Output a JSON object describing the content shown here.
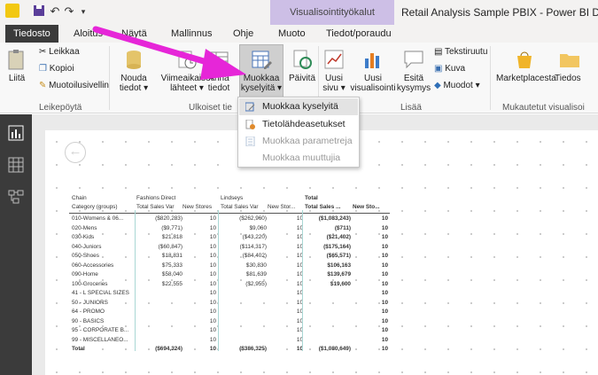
{
  "window": {
    "title": "Retail Analysis Sample PBIX - Power BI Deskto",
    "contextual_tab": "Visualisointityökalut"
  },
  "tabs": [
    "Tiedosto",
    "Aloitus",
    "Näytä",
    "Mallinnus",
    "Ohje",
    "Muoto",
    "Tiedot/poraudu"
  ],
  "ribbon": {
    "paste": "Liitä",
    "cut": "Leikkaa",
    "copy": "Kopioi",
    "format_painter": "Muotoilusivellin",
    "get_data": "Nouda\ntiedot",
    "recent_sources": "Viimeaikaiset\nlähteet",
    "enter_data": "Anna\ntiedot",
    "edit_queries": "Muokkaa\nkyselyitä",
    "refresh": "Päivitä",
    "new_page": "Uusi\nsivu",
    "new_visual": "Uusi\nvisualisointi",
    "ask_question": "Esitä\nkysymys",
    "text_box": "Tekstiruutu",
    "image": "Kuva",
    "shapes": "Muodot",
    "marketplace": "Marketplacesta",
    "from_file": "Tiedos",
    "groups": {
      "clipboard": "Leikepöytä",
      "external": "Ulkoiset tie",
      "insert": "Lisää",
      "custom": "Mukautetut visualisoi"
    }
  },
  "dropdown": [
    "Muokkaa kyselyitä",
    "Tietolähdeasetukset",
    "Muokkaa parametreja",
    "Muokkaa muuttujia"
  ],
  "matrix": {
    "col_headers_top": [
      "Chain",
      "Fashions Direct",
      "Lindseys",
      "Total"
    ],
    "col_headers": [
      "Category (groups)",
      "Total Sales Var",
      "New Stores",
      "Total Sales Var",
      "New Stor...",
      "Total Sales ...",
      "New Sto..."
    ],
    "rows": [
      [
        "010-Womens & 06...",
        "($820,283)",
        "10",
        "($262,960)",
        "10",
        "($1,083,243)",
        "10"
      ],
      [
        "020-Mens",
        "($9,771)",
        "10",
        "$9,060",
        "10",
        "($711)",
        "10"
      ],
      [
        "030-Kids",
        "$21,818",
        "10",
        "($43,220)",
        "10",
        "($21,402)",
        "10"
      ],
      [
        "040-Juniors",
        "($60,847)",
        "10",
        "($114,317)",
        "10",
        "($175,164)",
        "10"
      ],
      [
        "050-Shoes",
        "$18,831",
        "10",
        "($84,402)",
        "10",
        "($65,571)",
        "10"
      ],
      [
        "060-Accessories",
        "$75,333",
        "10",
        "$30,830",
        "10",
        "$106,163",
        "10"
      ],
      [
        "090-Home",
        "$58,040",
        "10",
        "$81,639",
        "10",
        "$139,679",
        "10"
      ],
      [
        "100-Groceries",
        "$22,555",
        "10",
        "($2,955)",
        "10",
        "$19,600",
        "10"
      ],
      [
        "41 - L SPECIAL SIZES",
        "",
        "10",
        "",
        "10",
        "",
        "10"
      ],
      [
        "50 - JUNIORS",
        "",
        "10",
        "",
        "10",
        "",
        "10"
      ],
      [
        "64 - PROMO",
        "",
        "10",
        "",
        "10",
        "",
        "10"
      ],
      [
        "90 - BASICS",
        "",
        "10",
        "",
        "10",
        "",
        "10"
      ],
      [
        "95 - CORPORATE B...",
        "",
        "10",
        "",
        "10",
        "",
        "10"
      ],
      [
        "99 - MISCELLANEO...",
        "",
        "10",
        "",
        "10",
        "",
        "10"
      ]
    ],
    "total": [
      "Total",
      "($694,324)",
      "10",
      "($386,325)",
      "10",
      "($1,080,649)",
      "10"
    ]
  }
}
